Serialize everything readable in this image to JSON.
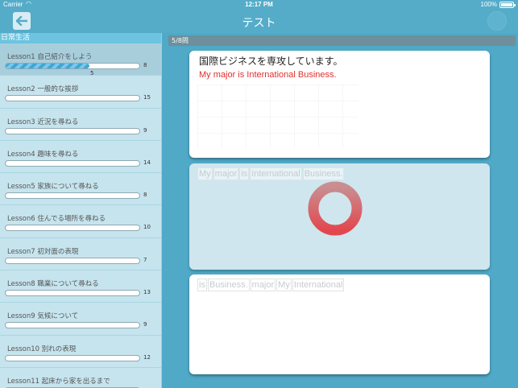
{
  "status": {
    "carrier": "Carrier",
    "time": "12:17 PM",
    "battery": "100%"
  },
  "nav": {
    "title": "テスト"
  },
  "sidebar": {
    "header": "日常生活",
    "lessons": [
      {
        "title": "Lesson1 自己紹介をしよう",
        "total": "8",
        "progress_label": "5",
        "progress": 0.625
      },
      {
        "title": "Lesson2 一般的な挨拶",
        "total": "15"
      },
      {
        "title": "Lesson3 近況を尋ねる",
        "total": "9"
      },
      {
        "title": "Lesson4 趣味を尋ねる",
        "total": "14"
      },
      {
        "title": "Lesson5 家族について尋ねる",
        "total": "8"
      },
      {
        "title": "Lesson6 住んでる場所を尋ねる",
        "total": "10"
      },
      {
        "title": "Lesson7 初対面の表現",
        "total": "7"
      },
      {
        "title": "Lesson8 職業について尋ねる",
        "total": "13"
      },
      {
        "title": "Lesson9 気候について",
        "total": "9"
      },
      {
        "title": "Lesson10 別れの表現",
        "total": "12"
      },
      {
        "title": "Lesson11 起床から家を出るまで",
        "total": ""
      }
    ]
  },
  "main": {
    "question_counter": "5/8問",
    "question_text": "国際ビジネスを専攻しています。",
    "translation": "My major is International Business.",
    "answer_words": [
      "My",
      "major",
      "is",
      "International",
      "Business."
    ],
    "choice_words": [
      "is",
      "Business.",
      "major",
      "My",
      "International"
    ]
  },
  "colors": {
    "nav_bg": "#54acc9",
    "translation": "#e0302d",
    "spinner": "#e05a5f",
    "sidebar_header": "#6cc4e0"
  }
}
